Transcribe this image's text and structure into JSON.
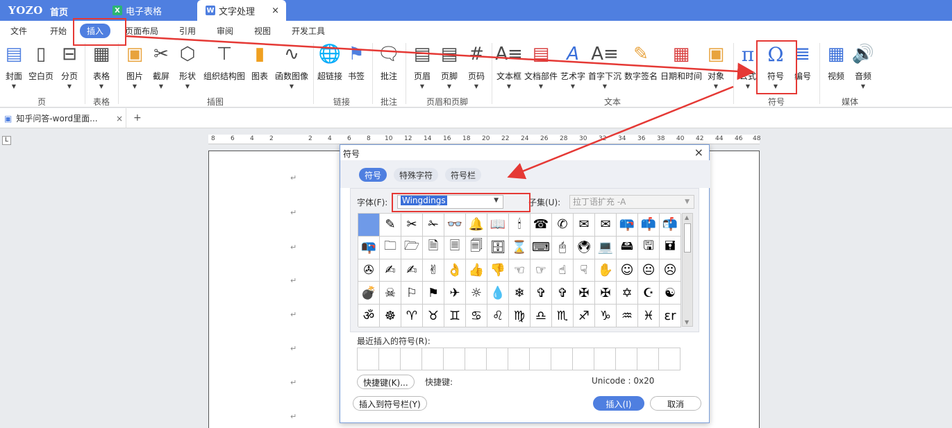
{
  "titlebar": {
    "logo": "YOZO",
    "home": "首页",
    "tabs": [
      {
        "label": "电子表格",
        "icon": "X",
        "color": "#2bb673"
      },
      {
        "label": "文字处理",
        "icon": "W",
        "color": "#4f7fe0"
      }
    ],
    "close": "×"
  },
  "menubar": [
    "文件",
    "开始",
    "插入",
    "页面布局",
    "引用",
    "审阅",
    "视图",
    "开发工具"
  ],
  "ribbon": {
    "buttons": [
      "封面",
      "空白页",
      "分页",
      "表格",
      "图片",
      "截屏",
      "形状",
      "组织结构图",
      "图表",
      "函数图像",
      "超链接",
      "书签",
      "批注",
      "页眉",
      "页脚",
      "页码",
      "文本框",
      "文档部件",
      "艺术字",
      "首字下沉",
      "数字签名",
      "日期和时间",
      "对象",
      "公式",
      "符号",
      "编号",
      "视频",
      "音频"
    ],
    "groups": [
      "页",
      "表格",
      "插图",
      "链接",
      "批注",
      "页眉和页脚",
      "文本",
      "符号",
      "媒体"
    ]
  },
  "doctab": {
    "title": "知乎问答-word里面...",
    "close": "×",
    "add": "+"
  },
  "ruler": [
    "8",
    "6",
    "4",
    "2",
    "2",
    "4",
    "6",
    "8",
    "10",
    "12",
    "14",
    "16",
    "18",
    "20",
    "22",
    "24",
    "26",
    "28",
    "30",
    "32",
    "34",
    "36",
    "38",
    "40",
    "42",
    "44",
    "46",
    "48"
  ],
  "corner": "L",
  "para_mark": "↵",
  "dialog": {
    "title": "符号",
    "close": "×",
    "tabs": [
      "符号",
      "特殊字符",
      "符号栏"
    ],
    "font_label": "字体(F):",
    "font_value": "Wingdings",
    "subset_label": "子集(U):",
    "subset_value": "拉丁语扩充 -A",
    "symbols": [
      "",
      "✎",
      "✂",
      "✁",
      "👓",
      "🔔",
      "📖",
      "🕯",
      "☎",
      "✆",
      "✉",
      "✉",
      "📪",
      "📫",
      "📬",
      "📭",
      "🗀",
      "🗁",
      "🗎",
      "🗏",
      "🗐",
      "🗄",
      "⌛",
      "⌨",
      "🖰",
      "🖲",
      "💻",
      "🖴",
      "🖫",
      "🖬",
      "✇",
      "✍",
      "✍",
      "✌",
      "👌",
      "👍",
      "👎",
      "☜",
      "☞",
      "☝",
      "☟",
      "✋",
      "☺",
      "😐",
      "☹",
      "💣",
      "☠",
      "⚐",
      "⚑",
      "✈",
      "☼",
      "💧",
      "❄",
      "✞",
      "✞",
      "✠",
      "✠",
      "✡",
      "☪",
      "☯",
      "ॐ",
      "☸",
      "♈",
      "♉",
      "♊",
      "♋",
      "♌",
      "♍",
      "♎",
      "♏",
      "♐",
      "♑",
      "♒",
      "♓",
      "ɛr"
    ],
    "recent_label": "最近插入的符号(R):",
    "shortcut_button": "快捷键(K)...",
    "shortcut_label": "快捷键:",
    "unicode": "Unicode : 0x20",
    "insert_bar_button": "插入到符号栏(Y)",
    "insert_button": "插入(I)",
    "cancel_button": "取消"
  },
  "colors": {
    "accent": "#4f7fe0",
    "highlight": "#e53935"
  }
}
